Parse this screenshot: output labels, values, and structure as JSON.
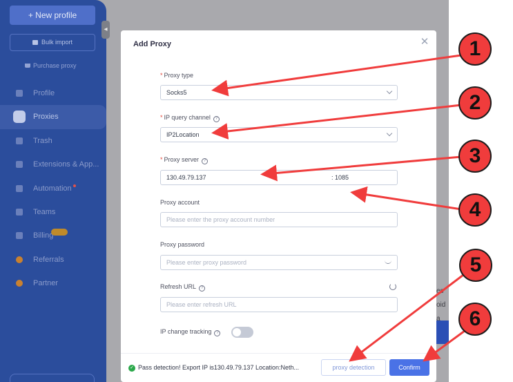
{
  "sidebar": {
    "new_profile": "+ New profile",
    "bulk_import": "Bulk import",
    "purchase_proxy": "Purchase proxy",
    "items": [
      {
        "label": "Profile",
        "icon": "profile-icon"
      },
      {
        "label": "Proxies",
        "icon": "proxies-icon",
        "active": true
      },
      {
        "label": "Trash",
        "icon": "trash-icon"
      },
      {
        "label": "Extensions & App...",
        "icon": "extensions-icon"
      },
      {
        "label": "Automation",
        "icon": "automation-icon"
      },
      {
        "label": "Teams",
        "icon": "teams-icon"
      },
      {
        "label": "Billing",
        "icon": "billing-icon"
      },
      {
        "label": "Referrals",
        "icon": "referrals-icon"
      },
      {
        "label": "Partner",
        "icon": "partner-icon"
      }
    ]
  },
  "background_peek": {
    "line1": "es",
    "line2": "oid a"
  },
  "modal": {
    "title": "Add Proxy",
    "close_icon": "close-icon",
    "proxy_type": {
      "label": "Proxy type",
      "required": "*",
      "value": "Socks5"
    },
    "ip_query_channel": {
      "label": "IP query channel",
      "required": "*",
      "value": "IP2Location"
    },
    "proxy_server": {
      "label": "Proxy server",
      "required": "*",
      "host": "130.49.79.137",
      "port": ": 1085"
    },
    "proxy_account": {
      "label": "Proxy account",
      "placeholder": "Please enter the proxy account number"
    },
    "proxy_password": {
      "label": "Proxy password",
      "placeholder": "Please enter proxy password"
    },
    "refresh_url": {
      "label": "Refresh URL",
      "placeholder": "Please enter refresh URL"
    },
    "ip_change_tracking": {
      "label": "IP change tracking",
      "enabled": false
    },
    "status": "Pass detection! Export IP is130.49.79.137 Location:Neth...",
    "proxy_detection_button": "proxy detection",
    "confirm_button": "Confirm"
  },
  "annotations": {
    "callouts": [
      "1",
      "2",
      "3",
      "4",
      "5",
      "6"
    ],
    "color": "#f03c3c"
  }
}
